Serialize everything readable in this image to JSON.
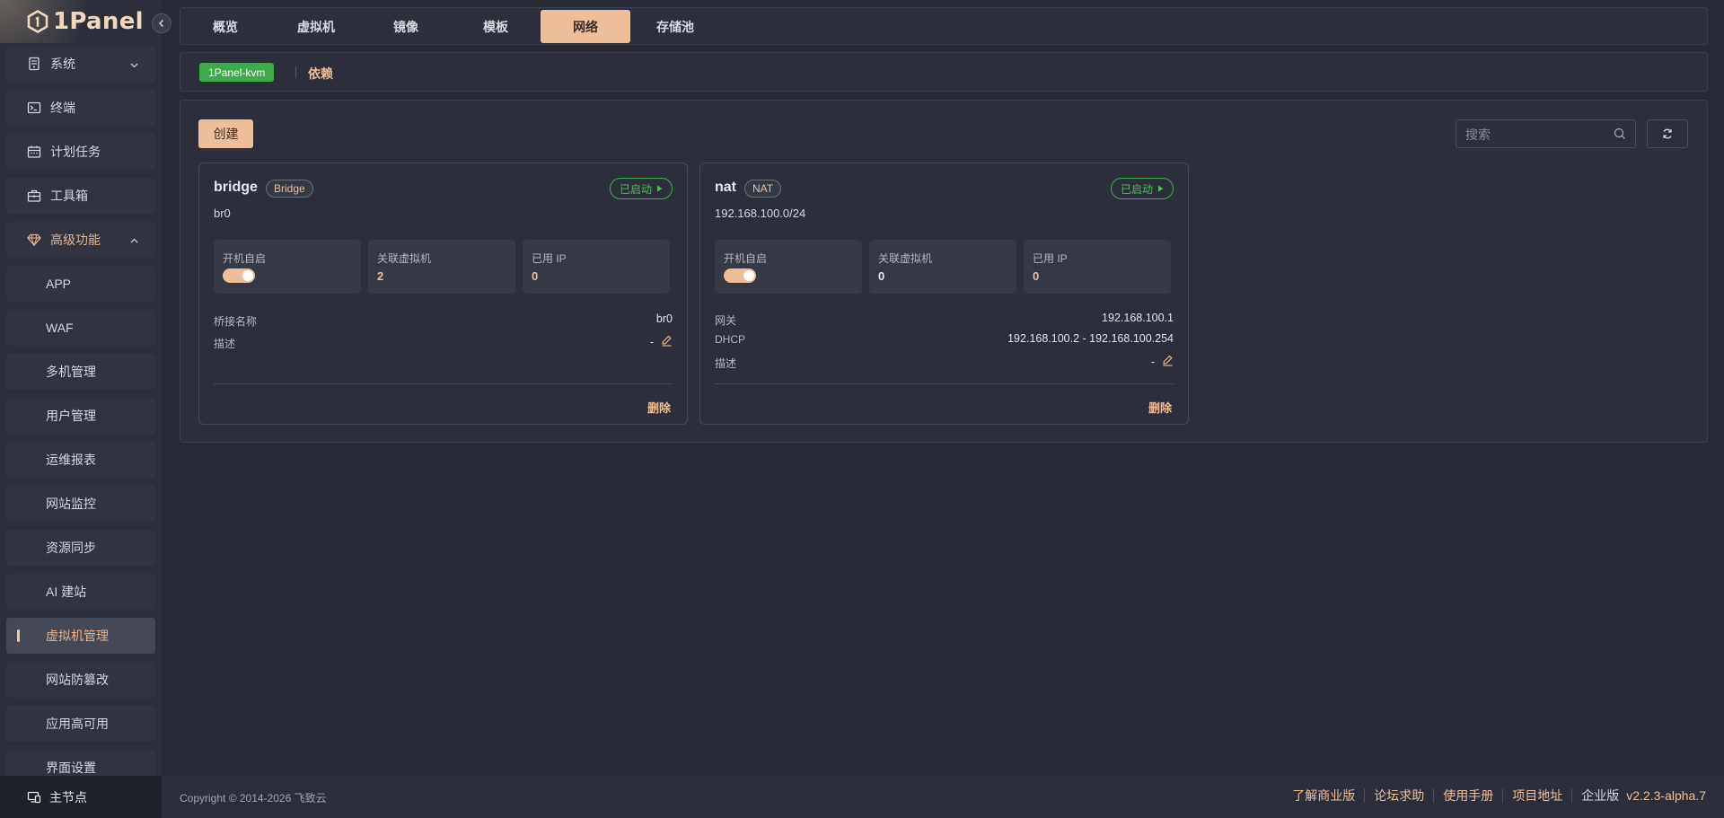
{
  "app": {
    "logo_text": "1Panel"
  },
  "sidebar": {
    "items": [
      {
        "label": "系统",
        "icon": "server-icon",
        "expandable": true
      },
      {
        "label": "终端",
        "icon": "terminal-icon"
      },
      {
        "label": "计划任务",
        "icon": "calendar-icon"
      },
      {
        "label": "工具箱",
        "icon": "toolbox-icon"
      },
      {
        "label": "高级功能",
        "icon": "diamond-icon",
        "expandable": true,
        "expanded": true
      }
    ],
    "sub_items": [
      {
        "label": "APP"
      },
      {
        "label": "WAF"
      },
      {
        "label": "多机管理"
      },
      {
        "label": "用户管理"
      },
      {
        "label": "运维报表"
      },
      {
        "label": "网站监控"
      },
      {
        "label": "资源同步"
      },
      {
        "label": "AI 建站"
      },
      {
        "label": "虚拟机管理",
        "active": true
      },
      {
        "label": "网站防篡改"
      },
      {
        "label": "应用高可用"
      },
      {
        "label": "界面设置"
      }
    ],
    "master_node": "主节点"
  },
  "tabs": [
    {
      "label": "概览"
    },
    {
      "label": "虚拟机"
    },
    {
      "label": "镜像"
    },
    {
      "label": "模板"
    },
    {
      "label": "网络",
      "active": true
    },
    {
      "label": "存储池"
    }
  ],
  "subbar": {
    "kvm_tag": "1Panel-kvm",
    "deps_link": "依赖"
  },
  "toolbar": {
    "create_label": "创建",
    "search_placeholder": "搜索"
  },
  "cards": [
    {
      "name": "bridge",
      "type": "Bridge",
      "subtitle": "br0",
      "status": "已启动",
      "stats": [
        {
          "label": "开机自启",
          "toggle": true
        },
        {
          "label": "关联虚拟机",
          "value": "2"
        },
        {
          "label": "已用 IP",
          "value": "0"
        }
      ],
      "rows": [
        {
          "key": "桥接名称",
          "value": "br0"
        },
        {
          "key": "描述",
          "value": "-",
          "editable": true
        }
      ],
      "delete_label": "删除"
    },
    {
      "name": "nat",
      "type": "NAT",
      "subtitle": "192.168.100.0/24",
      "status": "已启动",
      "stats": [
        {
          "label": "开机自启",
          "toggle": true
        },
        {
          "label": "关联虚拟机",
          "value": "0"
        },
        {
          "label": "已用 IP",
          "value": "0"
        }
      ],
      "rows": [
        {
          "key": "网关",
          "value": "192.168.100.1"
        },
        {
          "key": "DHCP",
          "value": "192.168.100.2 - 192.168.100.254"
        },
        {
          "key": "描述",
          "value": "-",
          "editable": true
        }
      ],
      "delete_label": "删除"
    }
  ],
  "footer": {
    "copyright": "Copyright © 2014-2026 飞致云",
    "links": [
      "了解商业版",
      "论坛求助",
      "使用手册",
      "项目地址"
    ],
    "edition": "企业版",
    "version": "v2.2.3-alpha.7"
  },
  "colors": {
    "accent": "#eebe98",
    "success": "#3eaa49",
    "background": "#272a35",
    "panel": "#2c2f3b"
  }
}
